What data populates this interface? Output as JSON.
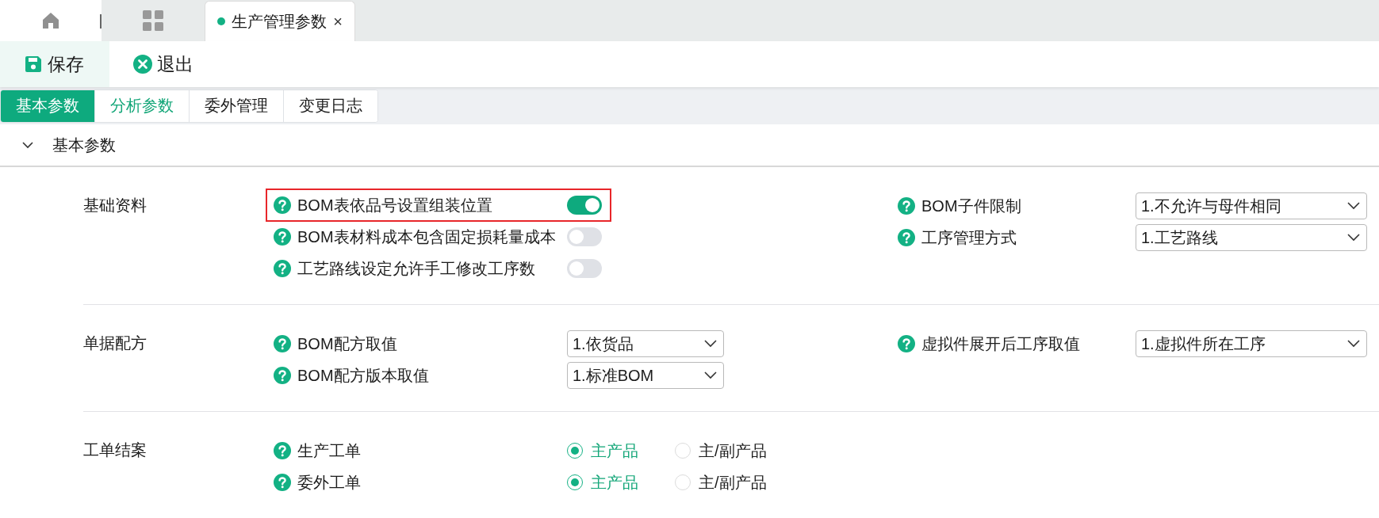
{
  "tab_bar": {
    "tabs": [
      {
        "kind": "home"
      },
      {
        "kind": "apps"
      },
      {
        "kind": "page",
        "label": "生产管理参数",
        "close": "×",
        "selected": true
      }
    ]
  },
  "toolbar": [
    {
      "kind": "save",
      "label": "保存",
      "selected": true
    },
    {
      "kind": "exit",
      "label": "退出",
      "selected": false
    }
  ],
  "subtabs": [
    {
      "label": "基本参数",
      "selected": true,
      "hover": false
    },
    {
      "label": "分析参数",
      "selected": false,
      "hover": true
    },
    {
      "label": "委外管理",
      "selected": false,
      "hover": false
    },
    {
      "label": "变更日志",
      "selected": false,
      "hover": false
    }
  ],
  "section": {
    "title": "基本参数",
    "expanded": true,
    "groups": [
      {
        "label": "基础资料",
        "left": [
          {
            "kind": "toggle",
            "label": "BOM表依品号设置组装位置",
            "on": true,
            "highlighted": true
          },
          {
            "kind": "toggle",
            "label": "BOM表材料成本包含固定损耗量成本",
            "on": false,
            "highlighted": false
          },
          {
            "kind": "toggle",
            "label": "工艺路线设定允许手工修改工序数",
            "on": false,
            "highlighted": false
          }
        ],
        "right": [
          {
            "kind": "select",
            "label": "BOM子件限制",
            "value": "1.不允许与母件相同"
          },
          {
            "kind": "select",
            "label": "工序管理方式",
            "value": "1.工艺路线"
          }
        ]
      },
      {
        "label": "单据配方",
        "left": [
          {
            "kind": "select",
            "label": "BOM配方取值",
            "value": "1.依货品"
          },
          {
            "kind": "select",
            "label": "BOM配方版本取值",
            "value": "1.标准BOM"
          }
        ],
        "right": [
          {
            "kind": "select",
            "label": "虚拟件展开后工序取值",
            "value": "1.虚拟件所在工序"
          }
        ]
      },
      {
        "label": "工单结案",
        "left": [
          {
            "kind": "radio",
            "label": "生产工单",
            "options": [
              {
                "label": "主产品",
                "selected": true
              },
              {
                "label": "主/副产品",
                "selected": false
              }
            ]
          },
          {
            "kind": "radio",
            "label": "委外工单",
            "options": [
              {
                "label": "主产品",
                "selected": true
              },
              {
                "label": "主/副产品",
                "selected": false
              }
            ]
          }
        ]
      }
    ]
  }
}
